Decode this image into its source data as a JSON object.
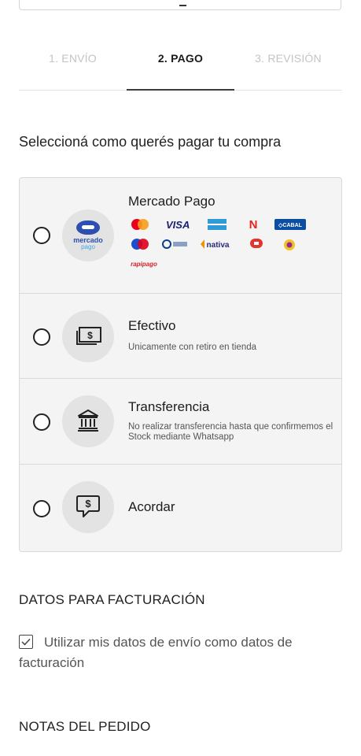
{
  "steps": [
    {
      "label": "1. ENVÍO",
      "state": "done"
    },
    {
      "label": "2. PAGO",
      "state": "active"
    },
    {
      "label": "3. REVISIÓN",
      "state": "pending"
    }
  ],
  "payment_section_title": "Seleccioná como querés pagar tu compra",
  "payment_options": [
    {
      "title": "Mercado Pago",
      "icon": "mercado-pago-logo",
      "logo_text_1": "mercado",
      "logo_text_2": "pago",
      "cards": [
        "Mastercard",
        "VISA",
        "American Express",
        "Naranja",
        "CABAL",
        "Maestro",
        "Diners Club",
        "nativa",
        "Argencard",
        "Cencosud",
        "rapipago"
      ],
      "selected": false
    },
    {
      "title": "Efectivo",
      "description": "Unicamente con retiro en tienda",
      "icon": "cash-icon",
      "selected": false
    },
    {
      "title": "Transferencia",
      "description": "No realizar transferencia hasta que confirmemos el Stock mediante Whatsapp",
      "icon": "bank-icon",
      "selected": false
    },
    {
      "title": "Acordar",
      "icon": "chat-money-icon",
      "selected": false
    }
  ],
  "billing": {
    "title": "DATOS PARA FACTURACIÓN",
    "checkbox_label": "Utilizar mis datos de envío como datos de facturación",
    "checked": true
  },
  "notes": {
    "title": "NOTAS DEL PEDIDO"
  },
  "colors": {
    "accent": "#3d3d3d",
    "option_bg": "#f4f4f4",
    "badge_bg": "#e3e3e3",
    "mp_blue": "#2d4fb0"
  }
}
